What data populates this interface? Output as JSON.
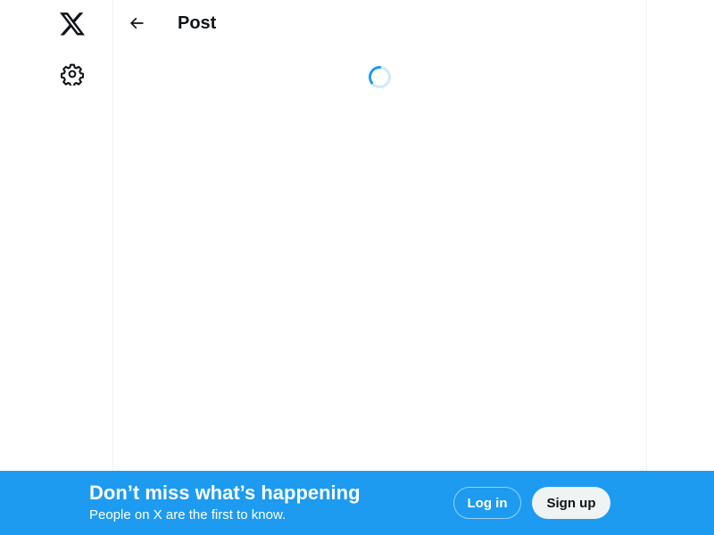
{
  "nav": {
    "logo_icon": "x-logo-icon",
    "settings_icon": "gear-icon"
  },
  "header": {
    "back_icon": "arrow-left-icon",
    "title": "Post"
  },
  "main": {
    "loading_icon": "loading-spinner-icon"
  },
  "banner": {
    "title": "Don’t miss what’s happening",
    "subtitle": "People on X are the first to know.",
    "login_label": "Log in",
    "signup_label": "Sign up"
  },
  "colors": {
    "accent": "#1d9bf0",
    "text": "#0f1419",
    "border": "#eff3f4",
    "signup_bg": "#eff3f4"
  }
}
